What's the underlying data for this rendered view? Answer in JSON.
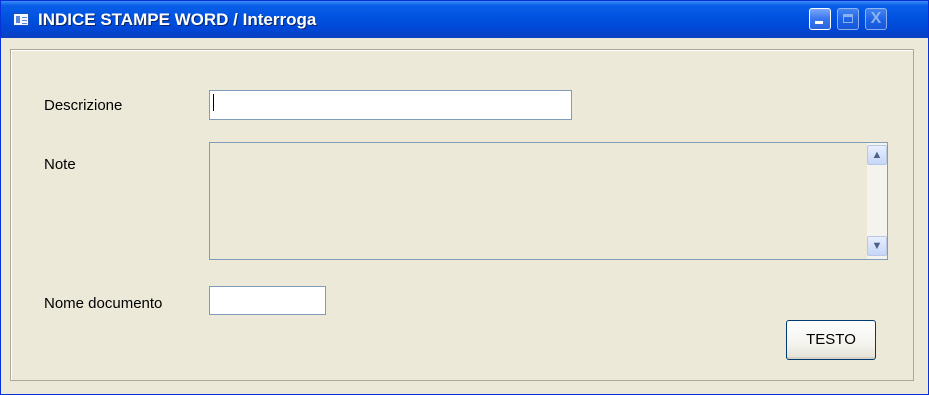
{
  "window": {
    "title": "INDICE STAMPE WORD / Interroga",
    "controls": {
      "minimize": "_",
      "maximize": "□",
      "close": "X"
    }
  },
  "form": {
    "descrizione": {
      "label": "Descrizione",
      "value": ""
    },
    "note": {
      "label": "Note",
      "value": ""
    },
    "nome_documento": {
      "label": "Nome documento",
      "value": ""
    },
    "testo_button": "TESTO"
  },
  "scrollbar": {
    "up": "▲",
    "down": "▼"
  }
}
